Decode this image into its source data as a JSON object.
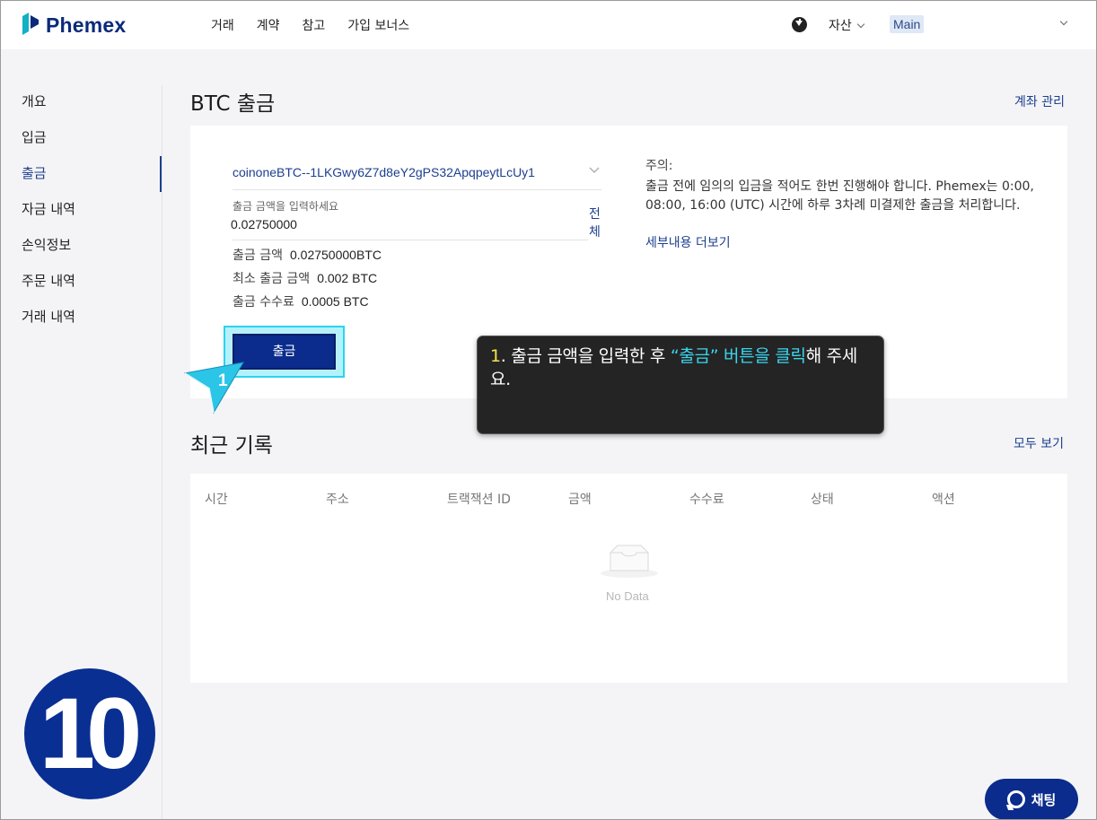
{
  "header": {
    "logo_text": "Phemex",
    "nav": [
      "거래",
      "계약",
      "참고",
      "가입 보너스"
    ],
    "assets_label": "자산",
    "account_badge": "Main"
  },
  "sidebar": {
    "items": [
      {
        "label": "개요",
        "active": false
      },
      {
        "label": "입금",
        "active": false
      },
      {
        "label": "출금",
        "active": true
      },
      {
        "label": "자금 내역",
        "active": false
      },
      {
        "label": "손익정보",
        "active": false
      },
      {
        "label": "주문 내역",
        "active": false
      },
      {
        "label": "거래 내역",
        "active": false
      }
    ]
  },
  "withdraw": {
    "title": "BTC 출금",
    "account_link": "계좌 관리",
    "address": "coinoneBTC--1LKGwy6Z7d8eY2gPS32ApqpeytLcUy1",
    "amount_label": "출금 금액을 입력하세요",
    "amount_value": "0.02750000",
    "all_label": "전체",
    "rows": [
      {
        "label": "출금 금액",
        "value": "0.02750000BTC"
      },
      {
        "label": "최소 출금 금액",
        "value": "0.002 BTC"
      },
      {
        "label": "출금 수수료",
        "value": "0.0005 BTC"
      }
    ],
    "button_label": "출금",
    "notice_title": "주의:",
    "notice_text": "출금 전에 임의의 입금을 적어도 한번 진행해야 합니다. Phemex는 0:00, 08:00, 16:00 (UTC) 시간에 하루 3차례 미결제한 출금을 처리합니다.",
    "notice_link": "세부내용 더보기"
  },
  "recent": {
    "title": "최근 기록",
    "view_all": "모두 보기",
    "columns": [
      "시간",
      "주소",
      "트랙잭션 ID",
      "금액",
      "수수료",
      "상태",
      "액션"
    ],
    "empty_text": "No Data"
  },
  "tooltip": {
    "num": "1",
    "part1": ". 출금 금액을 입력한 후 ",
    "highlight": "“출금” 버튼을 클릭",
    "part2": "해 주세요."
  },
  "pointer_label": "1",
  "step_number": "10",
  "chat_label": "채팅",
  "colors": {
    "brand": "#0b2c8c",
    "link": "#1d3f8f",
    "highlight_cyan": "#39d6ee",
    "highlight_yellow": "#f6e44a"
  }
}
